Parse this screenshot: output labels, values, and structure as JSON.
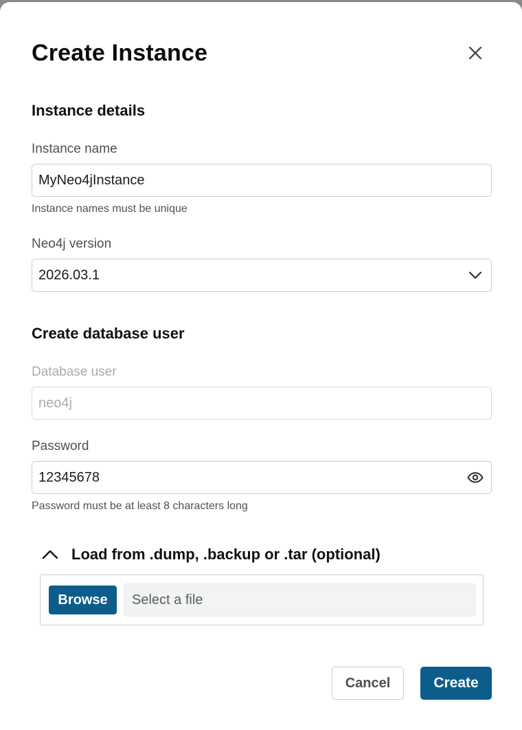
{
  "dialog": {
    "title": "Create Instance",
    "close_icon": "close-icon"
  },
  "instance_details": {
    "section_title": "Instance details",
    "name_label": "Instance name",
    "name_value": "MyNeo4jInstance",
    "name_help": "Instance names must be unique",
    "version_label": "Neo4j version",
    "version_value": "2026.03.1",
    "version_icon": "chevron-down-icon"
  },
  "database_user": {
    "section_title": "Create database user",
    "user_label": "Database user",
    "user_value": "neo4j",
    "password_label": "Password",
    "password_value": "12345678",
    "password_icon": "eye-icon",
    "password_help": "Password must be at least 8 characters long"
  },
  "load": {
    "toggle_label": "Load from .dump, .backup or .tar (optional)",
    "toggle_icon": "chevron-up-icon",
    "browse_label": "Browse",
    "file_placeholder": "Select a file"
  },
  "actions": {
    "cancel_label": "Cancel",
    "create_label": "Create"
  },
  "colors": {
    "primary": "#0d5d8c",
    "border": "#c9ccd1",
    "muted_text": "#4d5157",
    "disabled_text": "#a7abb1"
  }
}
